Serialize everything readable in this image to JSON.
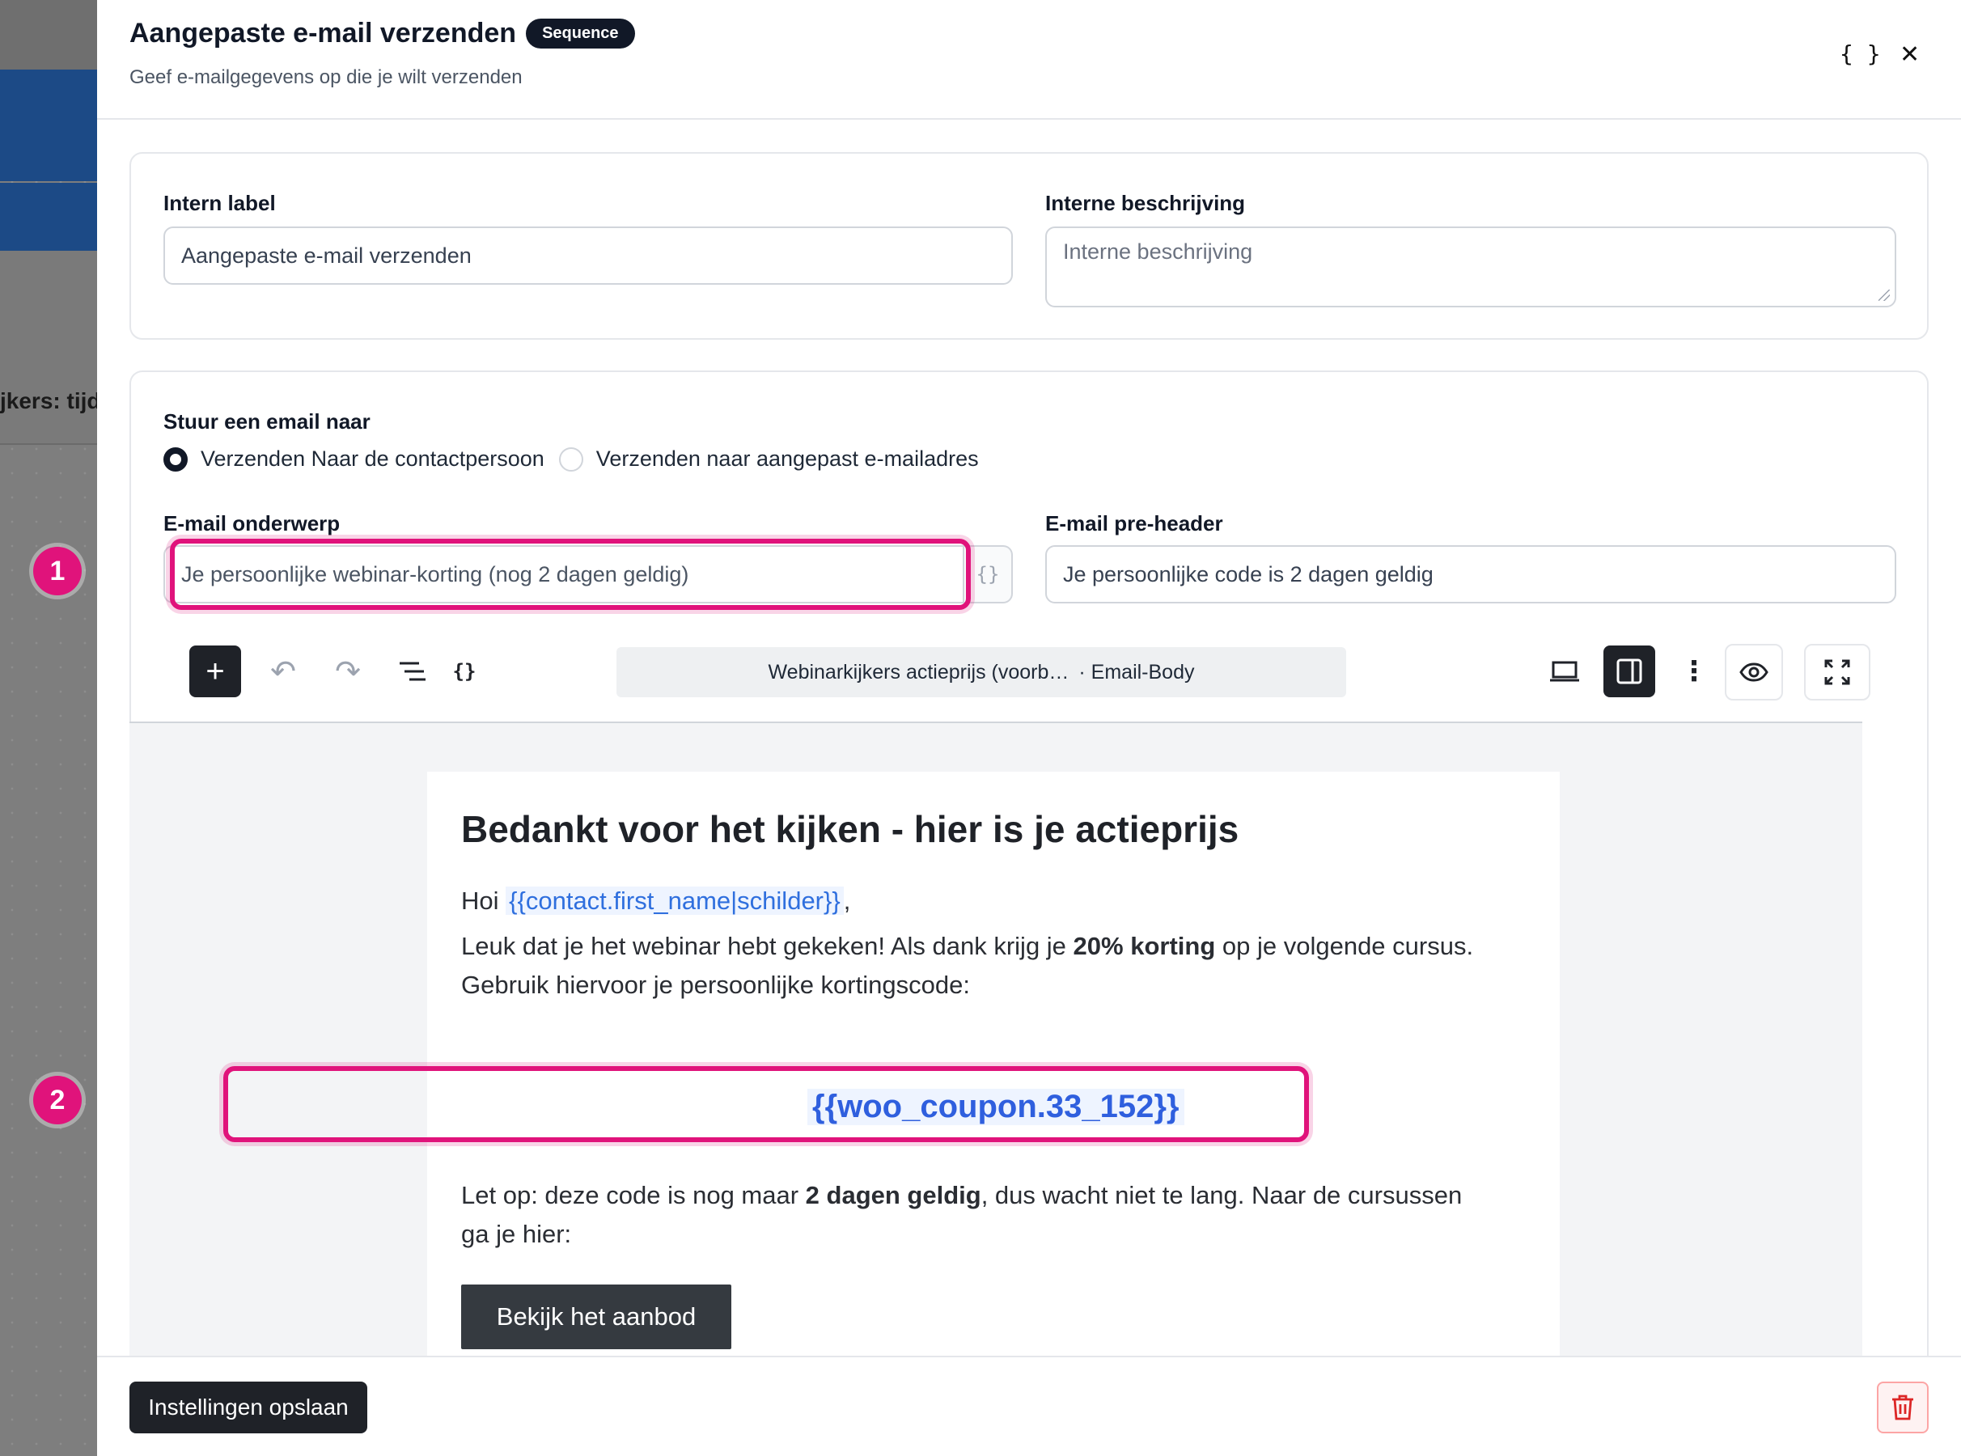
{
  "background": {
    "partial_text": "jkers: tijde",
    "markers": [
      "1",
      "2"
    ]
  },
  "header": {
    "title": "Aangepaste e-mail verzenden",
    "badge": "Sequence",
    "subtitle": "Geef e-mailgegevens op die je wilt verzenden",
    "code_icon": "{ }",
    "close_icon": "✕"
  },
  "settings": {
    "internal_label": {
      "label": "Intern label",
      "value": "Aangepaste e-mail verzenden"
    },
    "internal_description": {
      "label": "Interne beschrijving",
      "placeholder": "Interne beschrijving"
    }
  },
  "email": {
    "send_to_label": "Stuur een email naar",
    "send_to_options": [
      {
        "label": "Verzenden Naar de contactpersoon",
        "selected": true
      },
      {
        "label": "Verzenden naar aangepast e-mailadres",
        "selected": false
      }
    ],
    "subject": {
      "label": "E-mail onderwerp",
      "value": "Je persoonlijke webinar-korting (nog 2 dagen geldig)",
      "var_icon": "{}"
    },
    "preheader": {
      "label": "E-mail pre-header",
      "value": "Je persoonlijke code is 2 dagen geldig"
    }
  },
  "toolbar": {
    "add": "+",
    "undo": "↶",
    "redo": "↷",
    "doc_title": "Webinarkijkers actieprijs (voorb…",
    "doc_type": "· Email-Body"
  },
  "body": {
    "heading": "Bedankt voor het kijken - hier is je actieprijs",
    "greeting": "Hoi ",
    "greeting_var": "{{contact.first_name|schilder}}",
    "greeting_end": ",",
    "p1_a": "Leuk dat je het webinar hebt gekeken! Als dank krijg je ",
    "p1_bold": "20% korting",
    "p1_b": " op je volgende cursus.",
    "p1_line2": "Gebruik hiervoor je persoonlijke kortingscode:",
    "coupon": "{{woo_coupon.33_152}}",
    "p2_a": "Let op: deze code is nog maar ",
    "p2_bold": "2 dagen geldig",
    "p2_b": ", dus wacht niet te lang. Naar de cursussen",
    "p2_line2": "ga je hier:",
    "cta": "Bekijk het aanbod"
  },
  "footer": {
    "save": "Instellingen opslaan"
  },
  "colors": {
    "accent": "#e0137b",
    "dark": "#1f2228",
    "link": "#2f6fde"
  }
}
